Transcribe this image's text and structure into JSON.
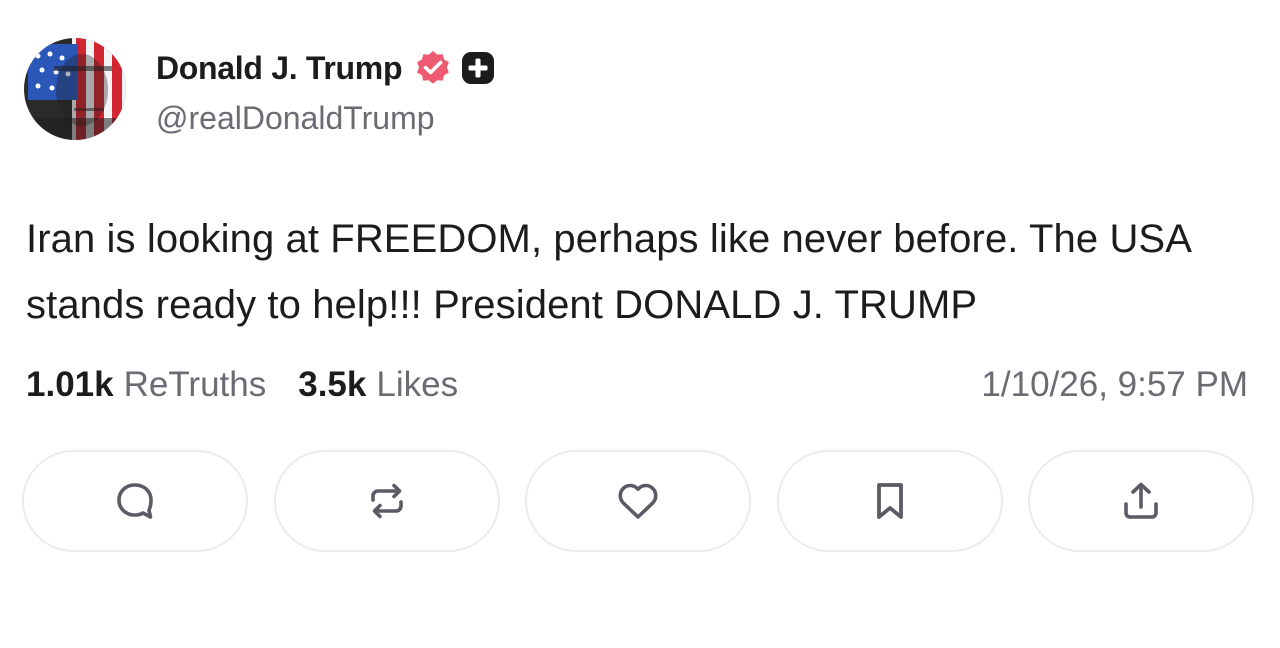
{
  "post": {
    "author": {
      "display_name": "Donald J. Trump",
      "handle": "@realDonaldTrump",
      "avatar_icon": "flag-portrait-avatar",
      "verified_icon": "verified-badge-icon",
      "plus_icon": "plus-badge-icon"
    },
    "text": "Iran is looking at FREEDOM, perhaps like never before. The USA stands ready to help!!! President DONALD J. TRUMP",
    "stats": {
      "retruths_count": "1.01k",
      "retruths_label": "ReTruths",
      "likes_count": "3.5k",
      "likes_label": "Likes"
    },
    "timestamp": "1/10/26, 9:57 PM"
  },
  "actions": [
    {
      "name": "reply",
      "icon": "comment-icon"
    },
    {
      "name": "retruth",
      "icon": "repost-icon"
    },
    {
      "name": "like",
      "icon": "heart-icon"
    },
    {
      "name": "bookmark",
      "icon": "bookmark-icon"
    },
    {
      "name": "share",
      "icon": "share-icon"
    }
  ],
  "colors": {
    "verified": "#ee5a6f",
    "text_primary": "#1c1c1e",
    "text_secondary": "#6b6b73",
    "button_border": "#ececef",
    "icon": "#5b5b66"
  }
}
